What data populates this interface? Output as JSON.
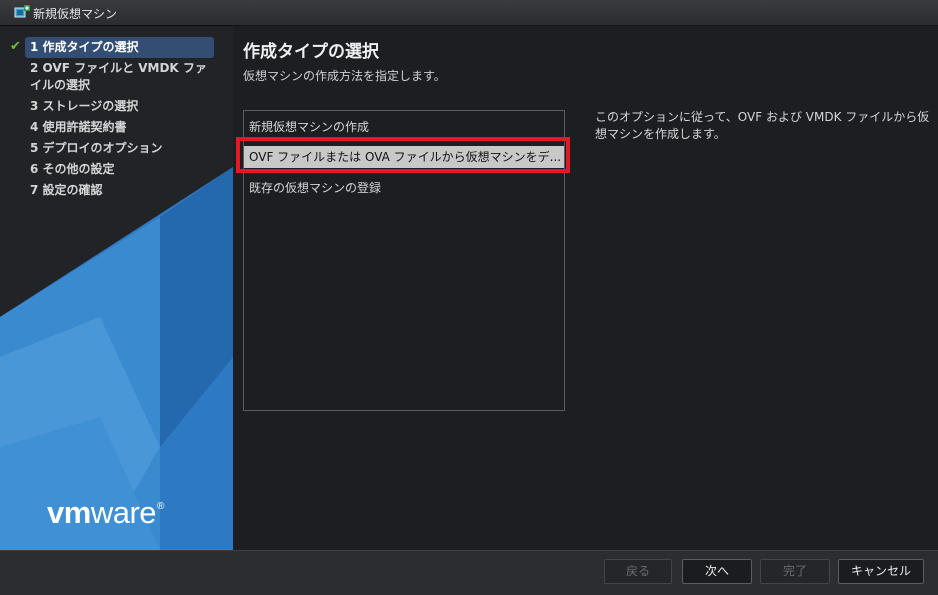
{
  "window": {
    "title": "新規仮想マシン",
    "icon": "vm-app-icon"
  },
  "sidebar": {
    "steps": [
      {
        "label": "1 作成タイプの選択",
        "active": true,
        "completed": true
      },
      {
        "label": "2 OVF ファイルと VMDK ファイルの選択"
      },
      {
        "label": "3 ストレージの選択"
      },
      {
        "label": "4 使用許諾契約書"
      },
      {
        "label": "5 デプロイのオプション"
      },
      {
        "label": "6 その他の設定"
      },
      {
        "label": "7 設定の確認"
      }
    ],
    "logo": {
      "brand_bold": "vm",
      "brand_rest": "ware",
      "mark": "®"
    }
  },
  "main": {
    "title": "作成タイプの選択",
    "subtitle": "仮想マシンの作成方法を指定します。",
    "options": [
      "新規仮想マシンの作成",
      "OVF ファイルまたは OVA ファイルから仮想マシンをデ...",
      "既存の仮想マシンの登録"
    ],
    "selected_option": 1,
    "description": "このオプションに従って、OVF および VMDK ファイルから仮想マシンを作成します。"
  },
  "footer": {
    "back": "戻る",
    "next": "次へ",
    "finish": "完了",
    "cancel": "キャンセル"
  },
  "colors": {
    "highlight": "#e01b24",
    "active_step": "#334e72",
    "selected_row": "#c8c8c8"
  }
}
